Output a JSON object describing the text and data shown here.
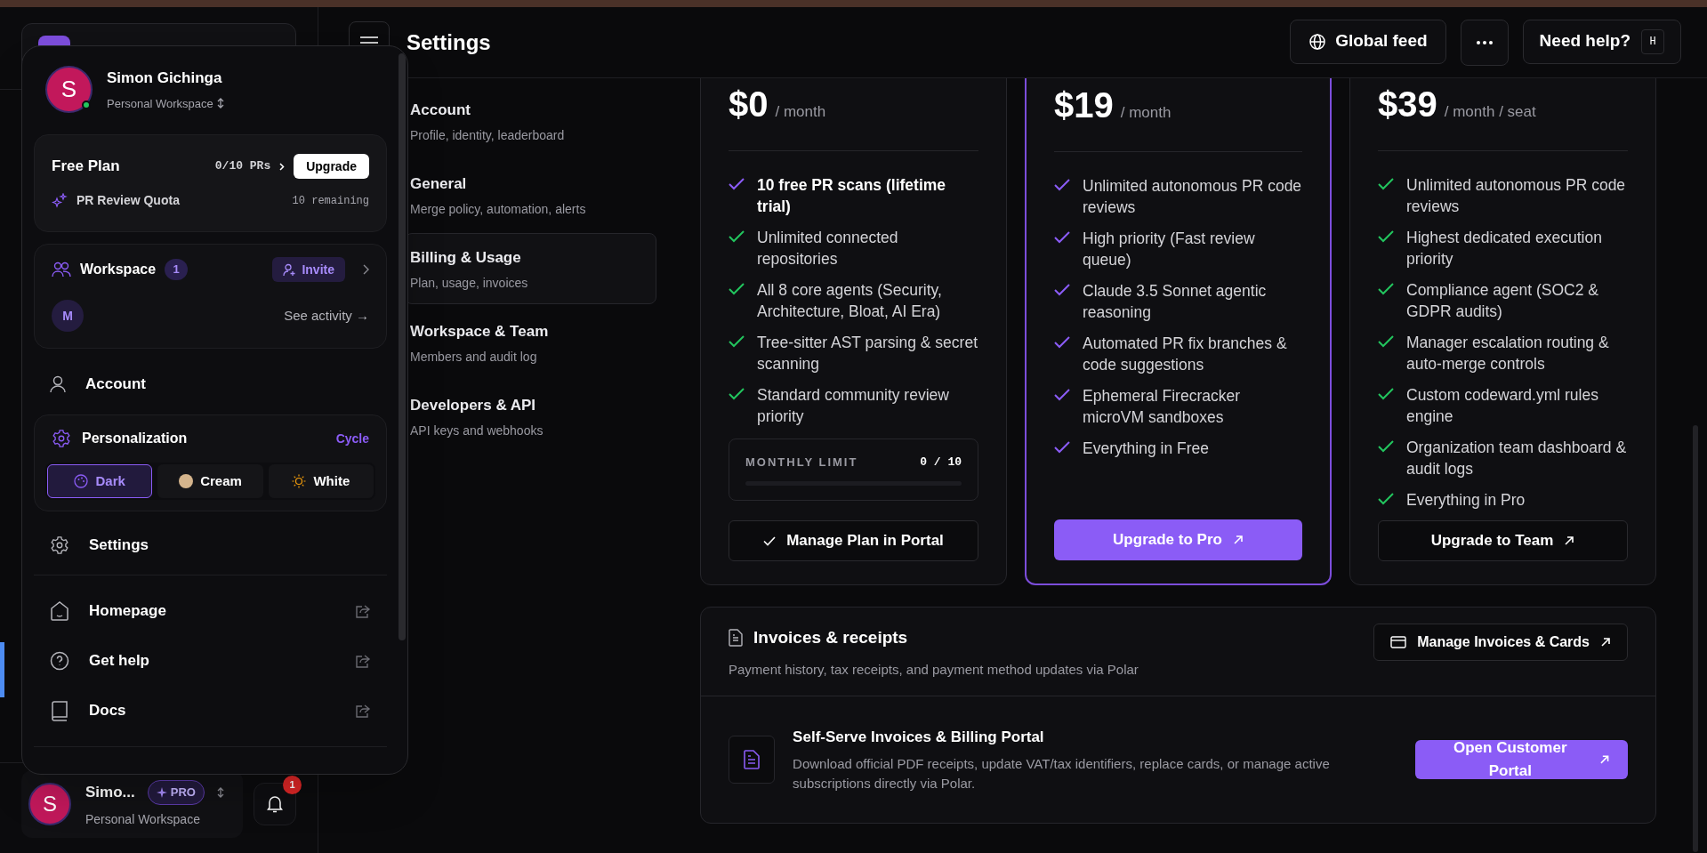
{
  "header": {
    "title": "Settings",
    "buttons": [
      {
        "kind": "globe",
        "label": "Global feed"
      },
      {
        "kind": "more"
      },
      {
        "kind": "help",
        "label": "Need help?",
        "shortcut": "H"
      }
    ]
  },
  "settings_nav": [
    {
      "title": "Account",
      "subtitle": "Profile, identity, leaderboard",
      "selected": false
    },
    {
      "title": "General",
      "subtitle": "Merge policy, automation, alerts",
      "selected": false
    },
    {
      "title": "Billing & Usage",
      "subtitle": "Plan, usage, invoices",
      "selected": true
    },
    {
      "title": "Workspace & Team",
      "subtitle": "Members and audit log",
      "selected": false
    },
    {
      "title": "Developers & API",
      "subtitle": "API keys and webhooks",
      "selected": false
    }
  ],
  "plans": [
    {
      "price": "$0",
      "period": "/ month",
      "featured": false,
      "features": [
        {
          "text": "10 free PR scans (lifetime trial)",
          "highlight": true
        },
        {
          "text": "Unlimited connected repositories",
          "highlight": false
        },
        {
          "text": "All 8 core agents (Security, Architecture, Bloat, AI Era)",
          "highlight": false
        },
        {
          "text": "Tree-sitter AST parsing & secret scanning",
          "highlight": false
        },
        {
          "text": "Standard community review priority",
          "highlight": false
        }
      ],
      "meter": {
        "label": "MONTHLY LIMIT",
        "reading": "0 / 10",
        "level": 0
      },
      "button": {
        "kind": "current",
        "label": "Manage Plan in Portal"
      }
    },
    {
      "price": "$19",
      "period": "/ month",
      "featured": true,
      "features": [
        {
          "text": "Unlimited autonomous PR code reviews",
          "highlight": false
        },
        {
          "text": "High priority (Fast review queue)",
          "highlight": false
        },
        {
          "text": "Claude 3.5 Sonnet agentic reasoning",
          "highlight": false
        },
        {
          "text": "Automated PR fix branches & code suggestions",
          "highlight": false
        },
        {
          "text": "Ephemeral Firecracker microVM sandboxes",
          "highlight": false
        },
        {
          "text": "Everything in Free",
          "highlight": false
        }
      ],
      "button": {
        "kind": "primary",
        "label": "Upgrade to Pro"
      }
    },
    {
      "price": "$39",
      "period": "/ month / seat",
      "featured": false,
      "features": [
        {
          "text": "Unlimited autonomous PR code reviews",
          "highlight": false
        },
        {
          "text": "Highest dedicated execution priority",
          "highlight": false
        },
        {
          "text": "Compliance agent (SOC2 & GDPR audits)",
          "highlight": false
        },
        {
          "text": "Manager escalation routing & auto-merge controls",
          "highlight": false
        },
        {
          "text": "Custom codeward.yml rules engine",
          "highlight": false
        },
        {
          "text": "Organization team dashboard & audit logs",
          "highlight": false
        },
        {
          "text": "Everything in Pro",
          "highlight": false
        }
      ],
      "button": {
        "kind": "outline",
        "label": "Upgrade to Team"
      }
    }
  ],
  "invoices": {
    "title": "Invoices & receipts",
    "subtitle": "Payment history, tax receipts, and payment method updates via Polar",
    "button": "Manage Invoices & Cards",
    "portal": {
      "title": "Self-Serve Invoices & Billing Portal",
      "description": "Download official PDF receipts, update VAT/tax identifiers, replace cards, or manage active subscriptions directly via Polar.",
      "button": "Open Customer Portal"
    }
  },
  "account_menu": {
    "user": {
      "initial": "S",
      "name": "Simon Gichinga",
      "workspace": "Personal Workspace",
      "online": true
    },
    "plan_card": {
      "title": "Free Plan",
      "usage": "0/10 PRs",
      "button": "Upgrade",
      "quota_label": "PR Review Quota",
      "quota_remaining": "10 remaining"
    },
    "workspace_card": {
      "title": "Workspace",
      "count": "1",
      "invite": "Invite",
      "member_initial": "M",
      "activity_link": "See activity →"
    },
    "account_item": {
      "label": "Account"
    },
    "personalization": {
      "title": "Personalization",
      "action": "Cycle",
      "themes": [
        {
          "kind": "dark",
          "label": "Dark",
          "selected": true
        },
        {
          "kind": "cream",
          "label": "Cream",
          "selected": false
        },
        {
          "kind": "white",
          "label": "White",
          "selected": false
        }
      ]
    },
    "settings_item": {
      "label": "Settings"
    },
    "links": [
      {
        "kind": "home",
        "label": "Homepage",
        "external": true
      },
      {
        "kind": "help",
        "label": "Get help",
        "external": true
      },
      {
        "kind": "docs",
        "label": "Docs",
        "external": true
      }
    ]
  },
  "sidebar_footer": {
    "initial": "S",
    "name": "Simo...",
    "badge": "PRO",
    "workspace": "Personal Workspace",
    "notifications": "1"
  }
}
